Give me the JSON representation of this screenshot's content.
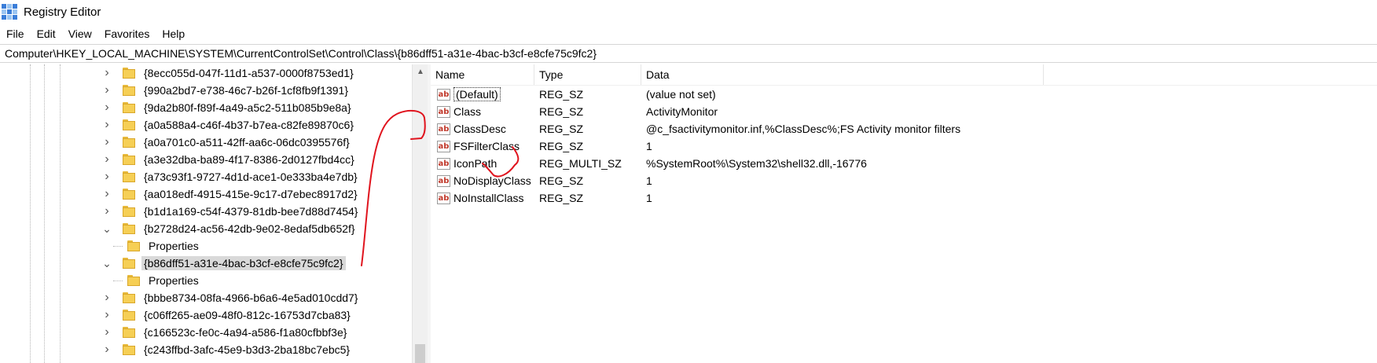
{
  "window": {
    "title": "Registry Editor"
  },
  "menu": [
    "File",
    "Edit",
    "View",
    "Favorites",
    "Help"
  ],
  "address": "Computer\\HKEY_LOCAL_MACHINE\\SYSTEM\\CurrentControlSet\\Control\\Class\\{b86dff51-a31e-4bac-b3cf-e8cfe75c9fc2}",
  "tree": [
    {
      "label": "{8ecc055d-047f-11d1-a537-0000f8753ed1}",
      "level": 1,
      "expanded": false
    },
    {
      "label": "{990a2bd7-e738-46c7-b26f-1cf8fb9f1391}",
      "level": 1,
      "expanded": false
    },
    {
      "label": "{9da2b80f-f89f-4a49-a5c2-511b085b9e8a}",
      "level": 1,
      "expanded": false
    },
    {
      "label": "{a0a588a4-c46f-4b37-b7ea-c82fe89870c6}",
      "level": 1,
      "expanded": false
    },
    {
      "label": "{a0a701c0-a511-42ff-aa6c-06dc0395576f}",
      "level": 1,
      "expanded": false
    },
    {
      "label": "{a3e32dba-ba89-4f17-8386-2d0127fbd4cc}",
      "level": 1,
      "expanded": false
    },
    {
      "label": "{a73c93f1-9727-4d1d-ace1-0e333ba4e7db}",
      "level": 1,
      "expanded": false
    },
    {
      "label": "{aa018edf-4915-415e-9c17-d7ebec8917d2}",
      "level": 1,
      "expanded": false
    },
    {
      "label": "{b1d1a169-c54f-4379-81db-bee7d88d7454}",
      "level": 1,
      "expanded": false
    },
    {
      "label": "{b2728d24-ac56-42db-9e02-8edaf5db652f}",
      "level": 1,
      "expanded": true
    },
    {
      "label": "Properties",
      "level": 2
    },
    {
      "label": "{b86dff51-a31e-4bac-b3cf-e8cfe75c9fc2}",
      "level": 1,
      "expanded": true,
      "selected": true
    },
    {
      "label": "Properties",
      "level": 2
    },
    {
      "label": "{bbbe8734-08fa-4966-b6a6-4e5ad010cdd7}",
      "level": 1,
      "expanded": false
    },
    {
      "label": "{c06ff265-ae09-48f0-812c-16753d7cba83}",
      "level": 1,
      "expanded": false
    },
    {
      "label": "{c166523c-fe0c-4a94-a586-f1a80cfbbf3e}",
      "level": 1,
      "expanded": false
    },
    {
      "label": "{c243ffbd-3afc-45e9-b3d3-2ba18bc7ebc5}",
      "level": 1,
      "expanded": false
    }
  ],
  "columns": [
    "Name",
    "Type",
    "Data"
  ],
  "values": [
    {
      "name": "(Default)",
      "type": "REG_SZ",
      "data": "(value not set)"
    },
    {
      "name": "Class",
      "type": "REG_SZ",
      "data": "ActivityMonitor"
    },
    {
      "name": "ClassDesc",
      "type": "REG_SZ",
      "data": "@c_fsactivitymonitor.inf,%ClassDesc%;FS Activity monitor filters"
    },
    {
      "name": "FSFilterClass",
      "type": "REG_SZ",
      "data": "1"
    },
    {
      "name": "IconPath",
      "type": "REG_MULTI_SZ",
      "data": "%SystemRoot%\\System32\\shell32.dll,-16776"
    },
    {
      "name": "NoDisplayClass",
      "type": "REG_SZ",
      "data": "1"
    },
    {
      "name": "NoInstallClass",
      "type": "REG_SZ",
      "data": "1"
    }
  ],
  "icons": {
    "string_value": "ab-icon",
    "app": "registry-icon",
    "scroll_up": "chevron-up-icon"
  },
  "colors": {
    "selection": "#d9d9d9",
    "annotation": "#e0141e",
    "folder": "#f6cf55",
    "ab_text": "#c0392b"
  }
}
